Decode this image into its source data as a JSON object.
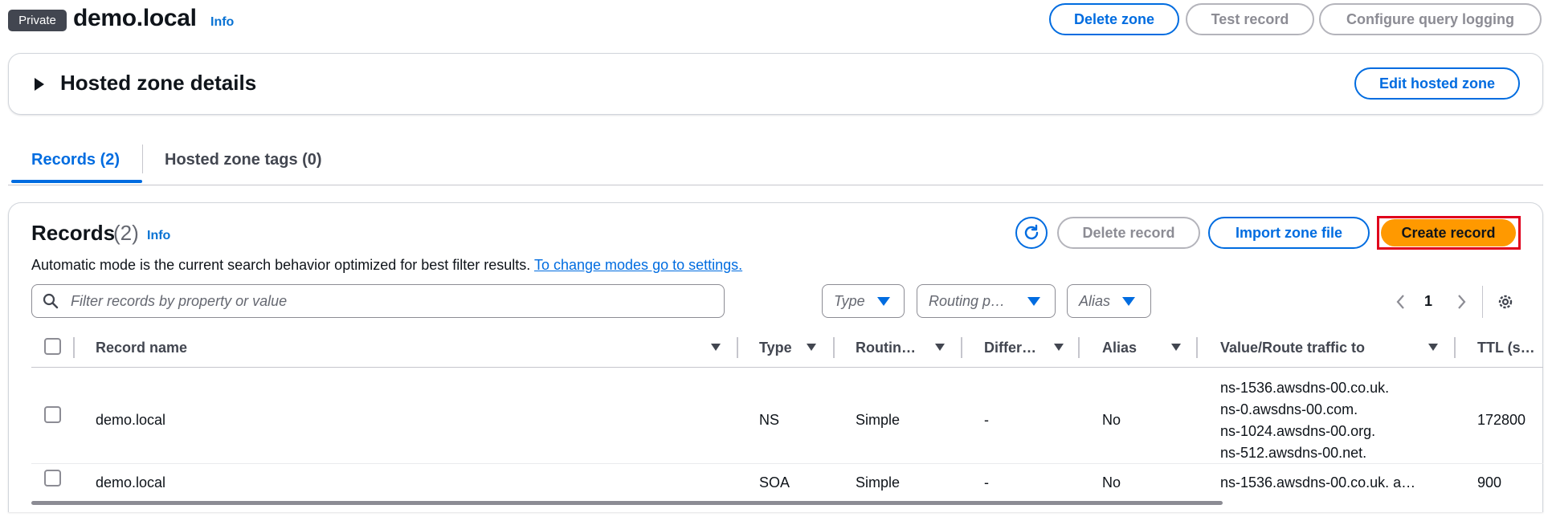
{
  "header": {
    "badge": "Private",
    "zone_name": "demo.local",
    "info": "Info",
    "buttons": {
      "delete_zone": "Delete zone",
      "test_record": "Test record",
      "configure_logging": "Configure query logging"
    }
  },
  "details": {
    "title": "Hosted zone details",
    "edit_button": "Edit hosted zone"
  },
  "tabs": [
    {
      "label": "Records (2)"
    },
    {
      "label": "Hosted zone tags (0)"
    }
  ],
  "records": {
    "title": "Records",
    "count": "(2)",
    "info": "Info",
    "buttons": {
      "delete": "Delete record",
      "import": "Import zone file",
      "create": "Create record"
    },
    "description": "Automatic mode is the current search behavior optimized for best filter results.",
    "settings_link": "To change modes go to settings.",
    "search_placeholder": "Filter records by property or value",
    "filters": {
      "type": "Type",
      "routing": "Routing p…",
      "alias": "Alias"
    },
    "page": "1",
    "columns": [
      "Record name",
      "Type",
      "Routin…",
      "Differ…",
      "Alias",
      "Value/Route traffic to",
      "TTL (s…"
    ],
    "rows": [
      {
        "name": "demo.local",
        "type": "NS",
        "routing": "Simple",
        "differ": "-",
        "alias": "No",
        "values": [
          "ns-1536.awsdns-00.co.uk.",
          "ns-0.awsdns-00.com.",
          "ns-1024.awsdns-00.org.",
          "ns-512.awsdns-00.net."
        ],
        "ttl": "172800"
      },
      {
        "name": "demo.local",
        "type": "SOA",
        "routing": "Simple",
        "differ": "-",
        "alias": "No",
        "values": [
          "ns-1536.awsdns-00.co.uk. a…"
        ],
        "ttl": "900"
      }
    ]
  }
}
